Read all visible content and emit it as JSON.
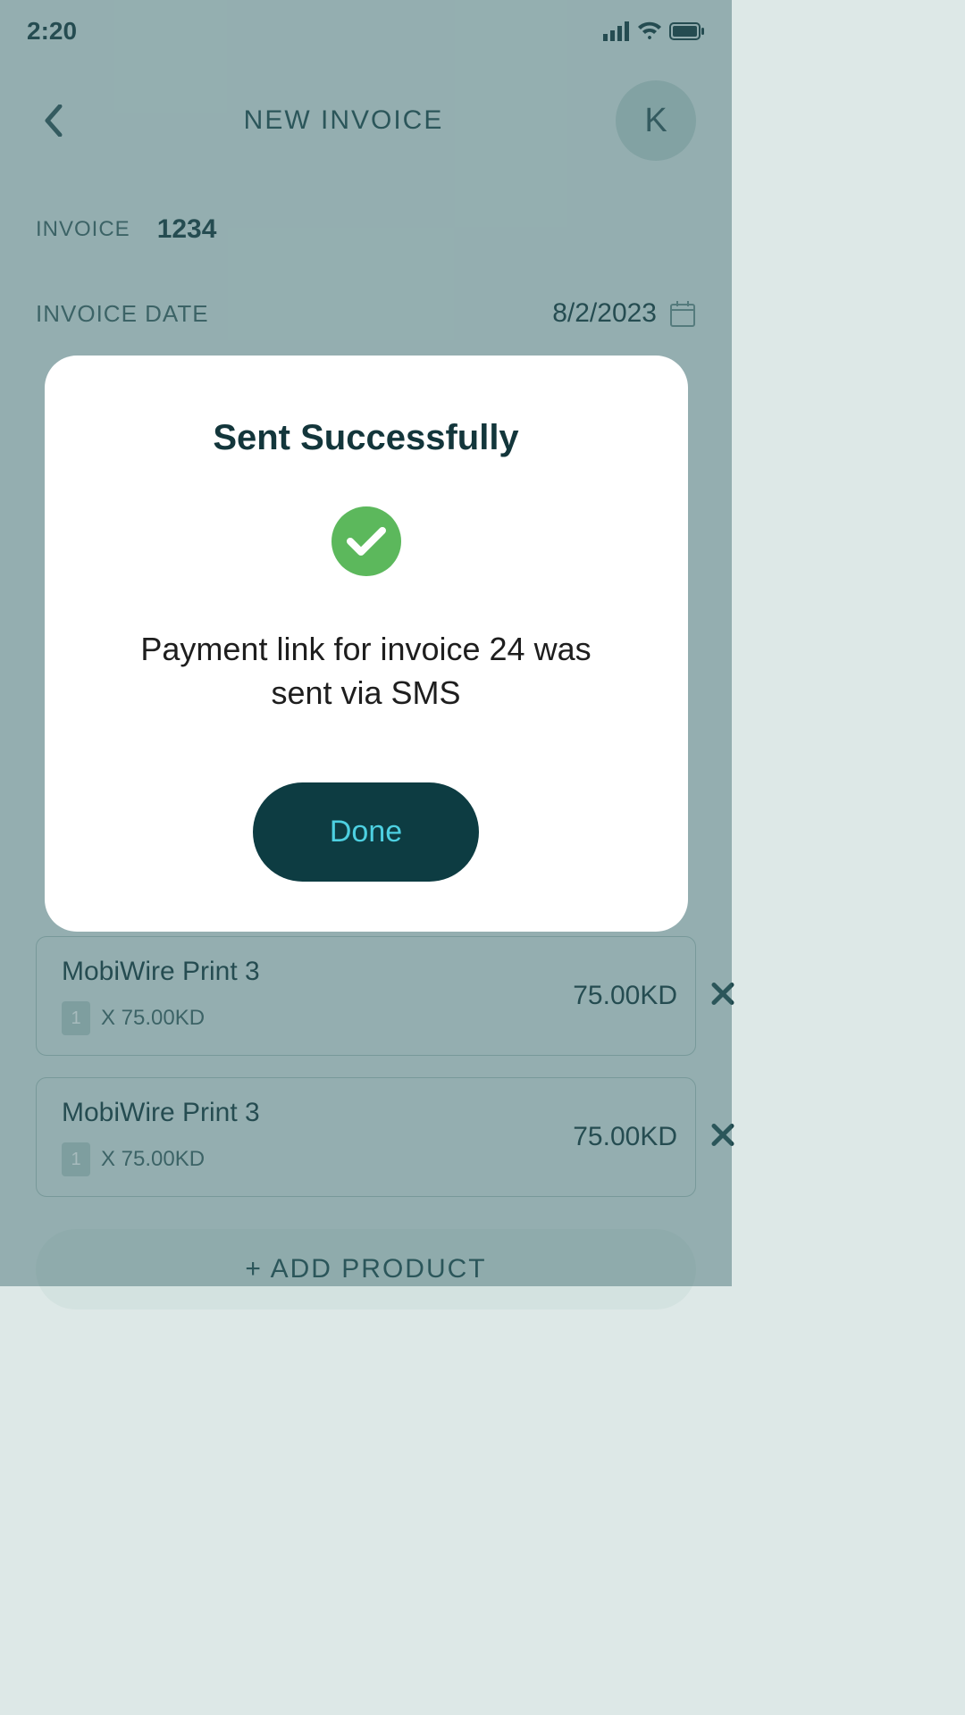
{
  "status_bar": {
    "time": "2:20"
  },
  "header": {
    "title": "NEW INVOICE",
    "avatar_initial": "K"
  },
  "invoice": {
    "label": "INVOICE",
    "number": "1234",
    "date_label": "INVOICE DATE",
    "date": "8/2/2023"
  },
  "products": [
    {
      "name": "MobiWire Print 3",
      "qty": "1",
      "qty_text": "X 75.00KD",
      "price": "75.00KD"
    },
    {
      "name": "MobiWire Print 3",
      "qty": "1",
      "qty_text": "X 75.00KD",
      "price": "75.00KD"
    }
  ],
  "add_product_label": "+ ADD PRODUCT",
  "modal": {
    "title": "Sent Successfully",
    "message": "Payment link for invoice 24 was sent via SMS",
    "button": "Done"
  }
}
